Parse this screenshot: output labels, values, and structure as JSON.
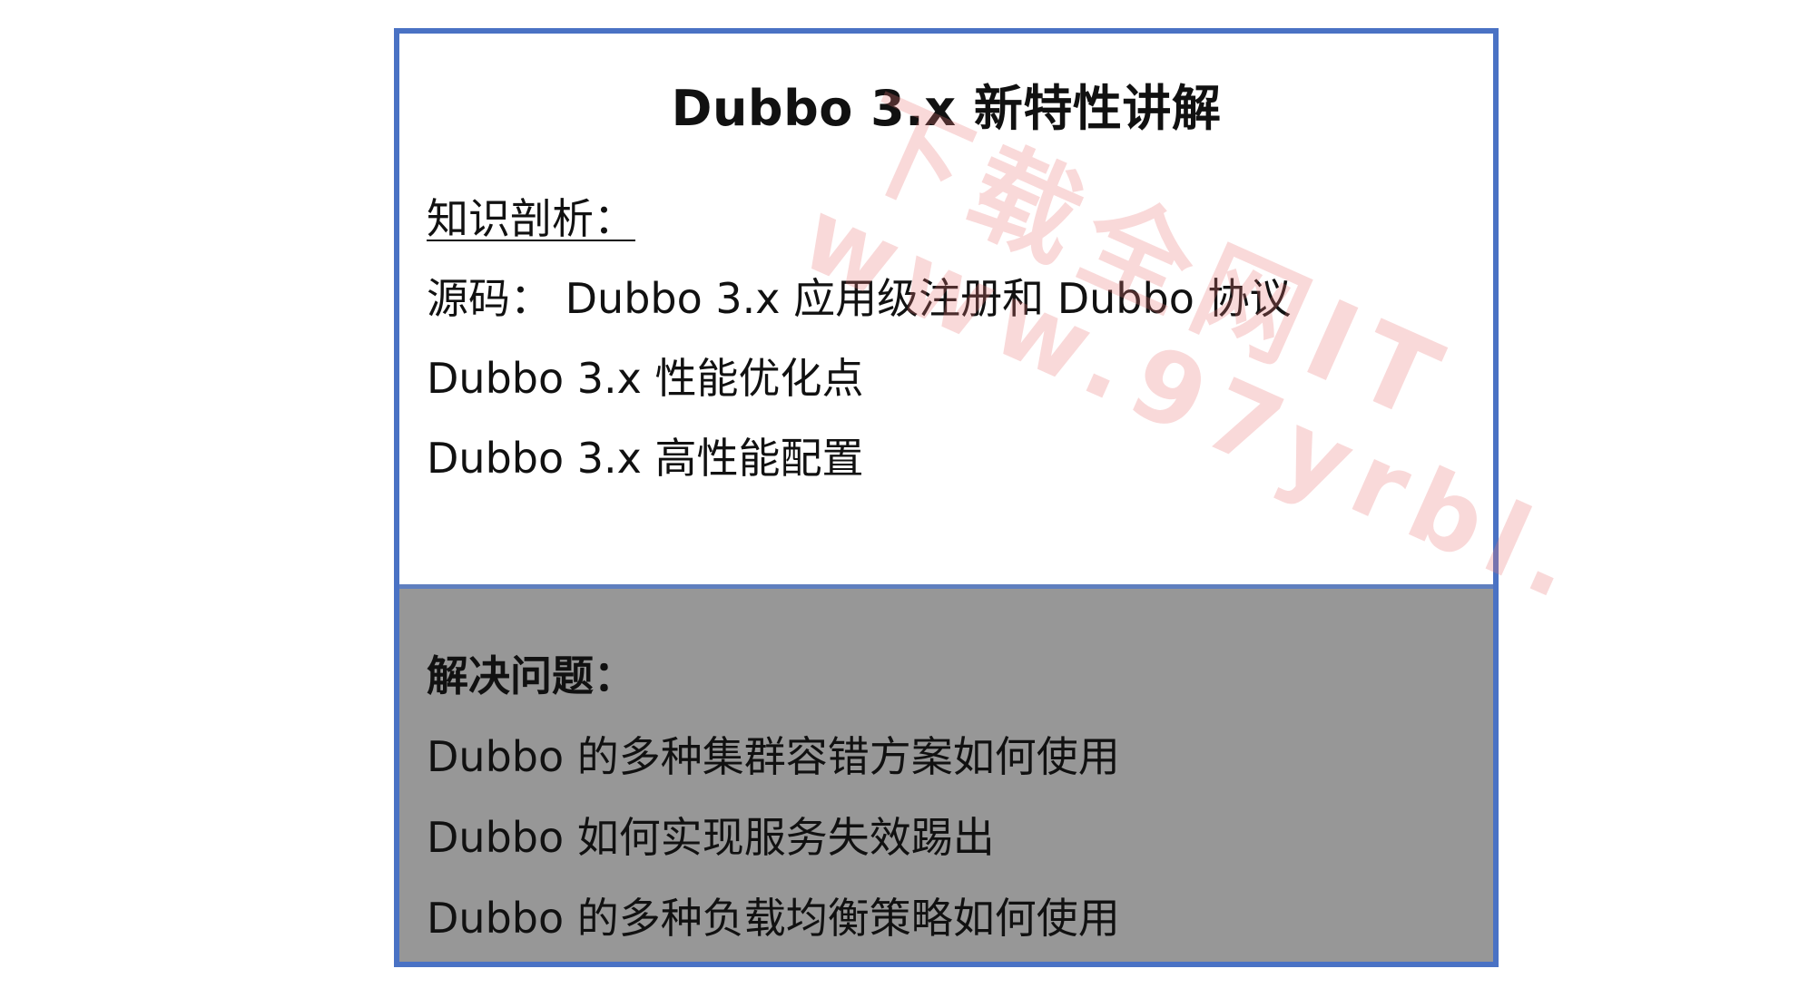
{
  "slide": {
    "title": "Dubbo 3.x 新特性讲解",
    "analysis": {
      "label": "知识剖析：",
      "lines": [
        "源码：  Dubbo 3.x 应用级注册和 Dubbo 协议",
        "Dubbo 3.x 性能优化点",
        "Dubbo 3.x 高性能配置"
      ]
    },
    "problems": {
      "label": "解决问题：",
      "lines": [
        "Dubbo 的多种集群容错方案如何使用",
        "Dubbo 如何实现服务失效踢出",
        "Dubbo 的多种负载均衡策略如何使用"
      ]
    }
  },
  "watermark": {
    "line1": "下载全网IT",
    "line2": "www.97yrbl.",
    "color": "#eb7878"
  },
  "colors": {
    "border": "#4a72c4",
    "bottom_panel": "#979797",
    "text": "#111111"
  }
}
